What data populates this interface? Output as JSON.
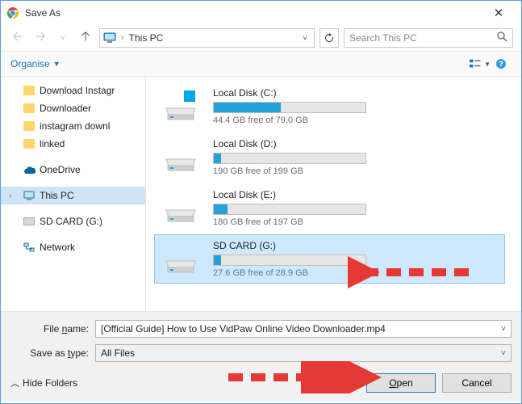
{
  "title": "Save As",
  "nav": {
    "location": "This PC",
    "search_placeholder": "Search This PC"
  },
  "toolbar": {
    "organise": "Organise"
  },
  "tree": {
    "items": [
      {
        "label": "Download Instagr",
        "kind": "folder"
      },
      {
        "label": "Downloader",
        "kind": "folder"
      },
      {
        "label": "instagram downl",
        "kind": "folder"
      },
      {
        "label": "linked",
        "kind": "folder"
      },
      {
        "label": "OneDrive",
        "kind": "onedrive"
      },
      {
        "label": "This PC",
        "kind": "pc",
        "selected": true
      },
      {
        "label": "SD CARD (G:)",
        "kind": "sd"
      },
      {
        "label": "Network",
        "kind": "network"
      }
    ]
  },
  "drives": [
    {
      "name": "Local Disk (C:)",
      "free": "44.4 GB free of 79.0 GB",
      "pct": 44,
      "os": true
    },
    {
      "name": "Local Disk (D:)",
      "free": "190 GB free of 199 GB",
      "pct": 5
    },
    {
      "name": "Local Disk (E:)",
      "free": "180 GB free of 197 GB",
      "pct": 9
    },
    {
      "name": "SD CARD (G:)",
      "free": "27.6 GB free of 28.9 GB",
      "pct": 5,
      "selected": true
    }
  ],
  "form": {
    "filename_label": "File name:",
    "filename_value": "[Official Guide] How to Use VidPaw Online Video Downloader.mp4",
    "savetype_label": "Save as type:",
    "savetype_value": "All Files",
    "hide_folders": "Hide Folders",
    "open": "Open",
    "cancel": "Cancel"
  }
}
